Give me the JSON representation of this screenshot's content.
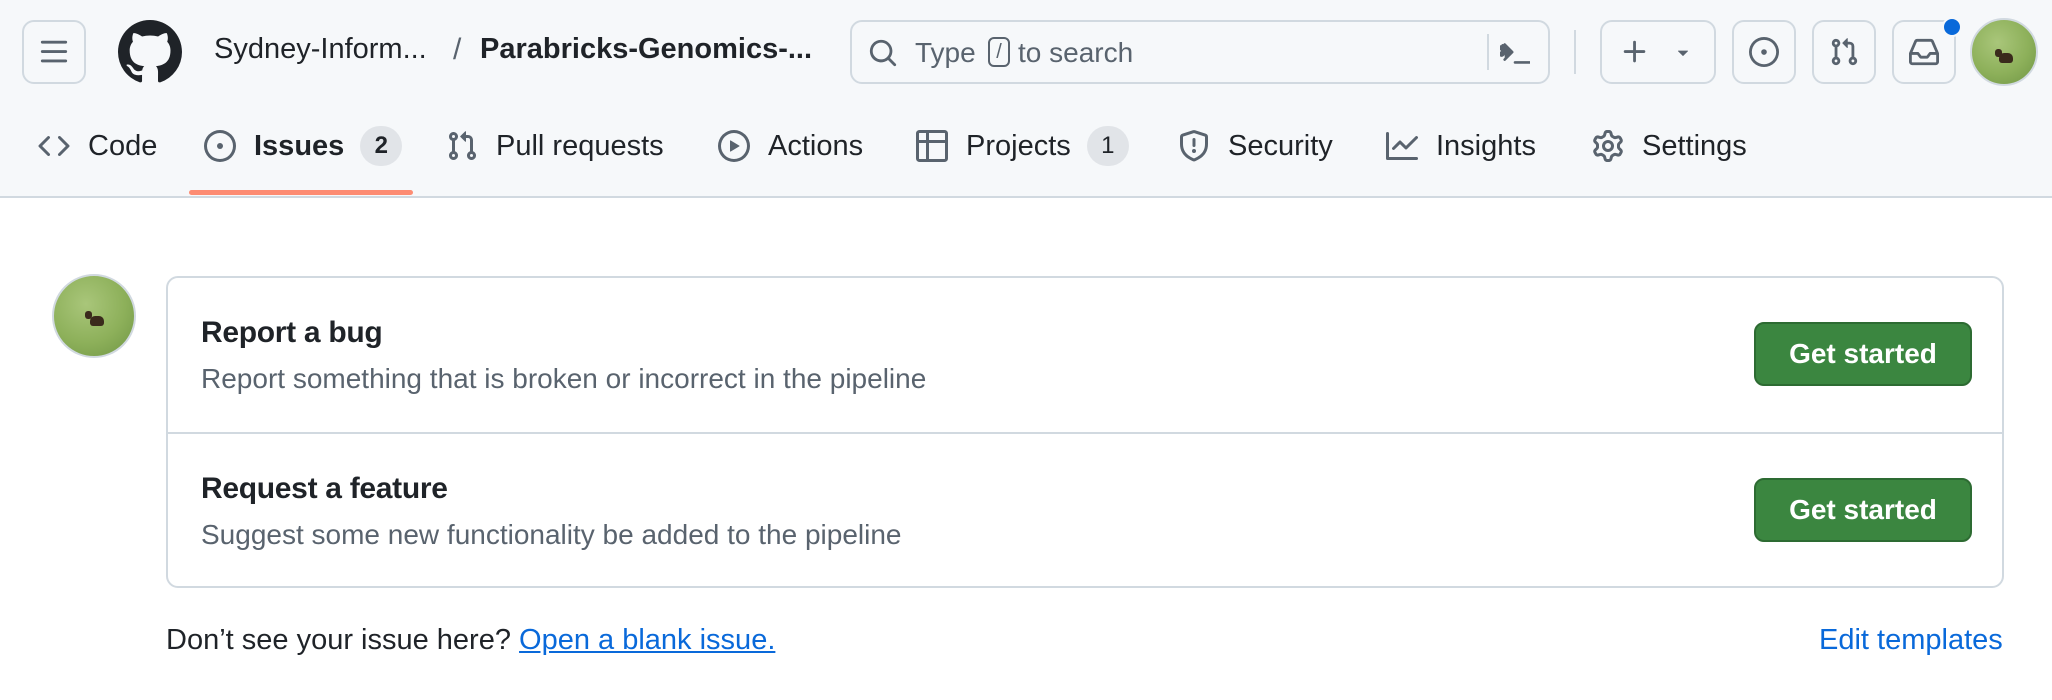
{
  "header": {
    "owner": "Sydney-Inform...",
    "separator": "/",
    "repo": "Parabricks-Genomics-...",
    "search": {
      "placeholder_before": "Type",
      "slash_key": "/",
      "placeholder_after": "to search"
    },
    "icons": {
      "menu": "hamburger-menu-icon",
      "logo": "github-logo-icon",
      "search": "search-icon",
      "command_palette": "command-palette-icon",
      "create": "plus-icon",
      "create_dropdown": "triangle-down-icon",
      "issues": "issue-opened-icon",
      "pulls": "git-pull-request-icon",
      "inbox": "inbox-icon"
    },
    "notification_color": "#0969da"
  },
  "tabs": [
    {
      "label": "Code",
      "icon": "code-icon"
    },
    {
      "label": "Issues",
      "icon": "issue-opened-icon",
      "count": "2",
      "selected": true
    },
    {
      "label": "Pull requests",
      "icon": "git-pull-request-icon"
    },
    {
      "label": "Actions",
      "icon": "play-icon"
    },
    {
      "label": "Projects",
      "icon": "table-icon",
      "count": "1"
    },
    {
      "label": "Security",
      "icon": "shield-icon"
    },
    {
      "label": "Insights",
      "icon": "graph-icon"
    },
    {
      "label": "Settings",
      "icon": "gear-icon"
    }
  ],
  "selected_tab_accent": "#fd8c73",
  "templates": [
    {
      "title": "Report a bug",
      "description": "Report something that is broken or incorrect in the pipeline",
      "button": "Get started"
    },
    {
      "title": "Request a feature",
      "description": "Suggest some new functionality be added to the pipeline",
      "button": "Get started"
    }
  ],
  "button_color": "#3b8640",
  "footer": {
    "prompt": "Don’t see your issue here?",
    "blank_issue_link": "Open a blank issue.",
    "edit_templates": "Edit templates"
  }
}
